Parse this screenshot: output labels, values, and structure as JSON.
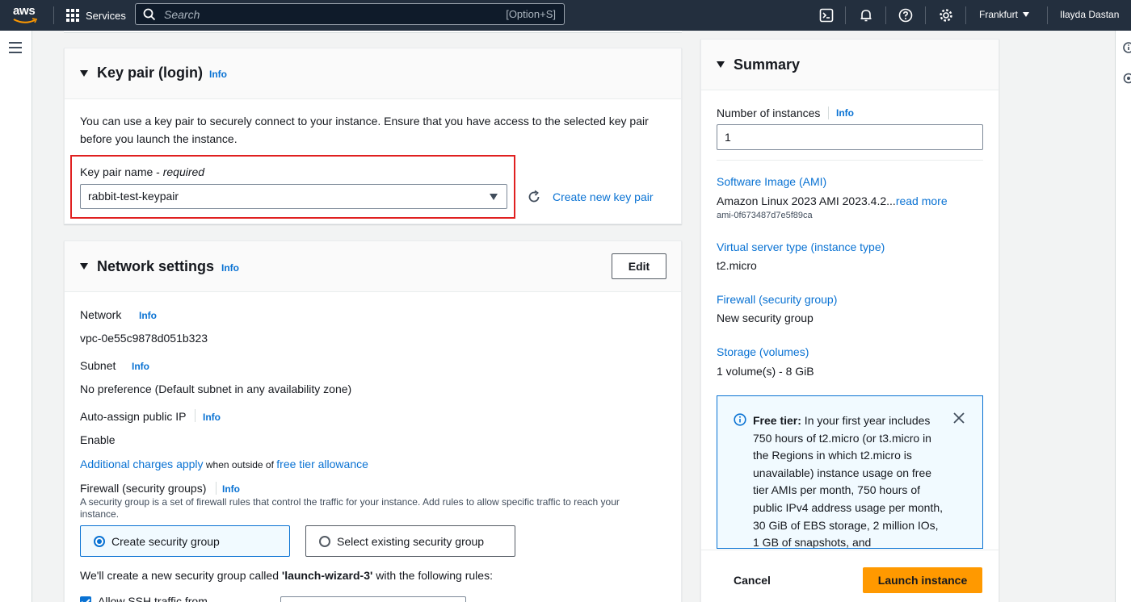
{
  "topnav": {
    "logo_text": "aws",
    "services_label": "Services",
    "search_placeholder": "Search",
    "search_shortcut": "[Option+S]",
    "region": "Frankfurt",
    "user": "Ilayda Dastan"
  },
  "key_pair": {
    "title": "Key pair (login)",
    "info": "Info",
    "description": "You can use a key pair to securely connect to your instance. Ensure that you have access to the selected key pair before you launch the instance.",
    "field_label": "Key pair name - ",
    "field_required": "required",
    "selected_value": "rabbit-test-keypair",
    "create_link": "Create new key pair"
  },
  "network": {
    "title": "Network settings",
    "info": "Info",
    "edit_label": "Edit",
    "network_label": "Network",
    "network_value": "vpc-0e55c9878d051b323",
    "subnet_label": "Subnet",
    "subnet_value": "No preference (Default subnet in any availability zone)",
    "auto_ip_label": "Auto-assign public IP",
    "auto_ip_value": "Enable",
    "charges_link": "Additional charges apply",
    "charges_mid": " when outside of ",
    "free_tier_link": "free tier allowance",
    "firewall_label": "Firewall (security groups)",
    "firewall_desc": "A security group is a set of firewall rules that control the traffic for your instance. Add rules to allow specific traffic to reach your instance.",
    "option_create": "Create security group",
    "option_existing": "Select existing security group",
    "sg_note_pre": "We'll create a new security group called ",
    "sg_note_name": "'launch-wizard-3'",
    "sg_note_post": " with the following rules:",
    "ssh_label": "Allow SSH traffic from"
  },
  "summary": {
    "title": "Summary",
    "instances_label": "Number of instances",
    "info": "Info",
    "instances_value": "1",
    "ami_link": "Software Image (AMI)",
    "ami_value": "Amazon Linux 2023 AMI 2023.4.2...",
    "read_more": "read more",
    "ami_id": "ami-0f673487d7e5f89ca",
    "type_link": "Virtual server type (instance type)",
    "type_value": "t2.micro",
    "firewall_link": "Firewall (security group)",
    "firewall_value": "New security group",
    "storage_link": "Storage (volumes)",
    "storage_value": "1 volume(s) - 8 GiB",
    "free_tier_bold": "Free tier:",
    "free_tier_text": " In your first year includes 750 hours of t2.micro (or t3.micro in the Regions in which t2.micro is unavailable) instance usage on free tier AMIs per month, 750 hours of public IPv4 address usage per month, 30 GiB of EBS storage, 2 million IOs, 1 GB of snapshots, and",
    "cancel_label": "Cancel",
    "launch_label": "Launch instance"
  },
  "colors": {
    "accent": "#0972d3",
    "launch": "#ff9900",
    "nav": "#232f3e",
    "highlight": "#e02020"
  }
}
